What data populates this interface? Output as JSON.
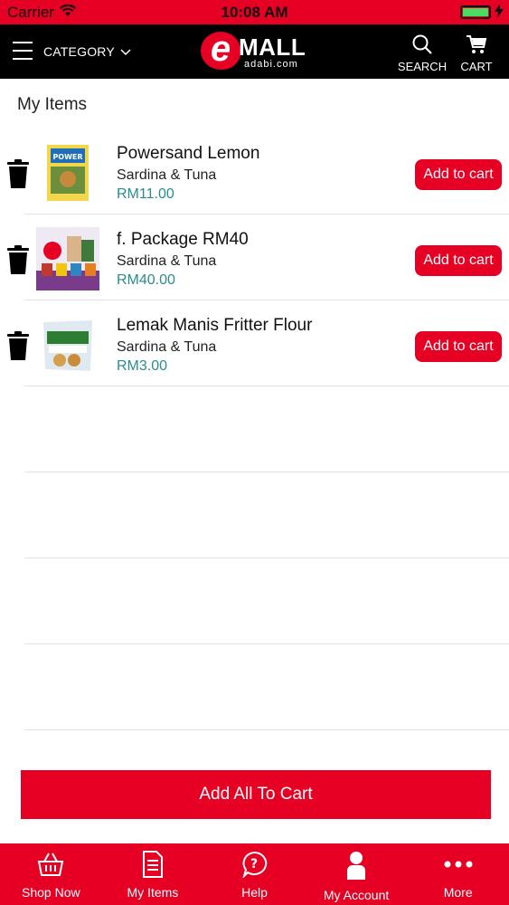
{
  "status_bar": {
    "carrier": "Carrier",
    "time": "10:08 AM"
  },
  "header": {
    "category_label": "CATEGORY",
    "logo_e": "e",
    "logo_mall": "MALL",
    "logo_domain": "adabi.com",
    "search_label": "SEARCH",
    "cart_label": "CART"
  },
  "main": {
    "section_title": "My Items",
    "items": [
      {
        "name": "Powersand Lemon",
        "category": "Sardina & Tuna",
        "price": "RM11.00",
        "add_label": "Add to cart"
      },
      {
        "name": "f. Package RM40",
        "category": "Sardina & Tuna",
        "price": "RM40.00",
        "add_label": "Add to cart"
      },
      {
        "name": "Lemak Manis Fritter Flour",
        "category": "Sardina & Tuna",
        "price": "RM3.00",
        "add_label": "Add to cart"
      }
    ],
    "add_all_label": "Add All To Cart"
  },
  "tab_bar": {
    "tabs": [
      {
        "label": "Shop Now",
        "icon": "basket-icon"
      },
      {
        "label": "My Items",
        "icon": "document-icon"
      },
      {
        "label": "Help",
        "icon": "help-icon"
      },
      {
        "label": "My Account",
        "icon": "user-icon"
      },
      {
        "label": "More",
        "icon": "more-icon"
      }
    ]
  },
  "colors": {
    "brand_red": "#e60023",
    "header_black": "#000000",
    "price_teal": "#2a8c8c"
  }
}
